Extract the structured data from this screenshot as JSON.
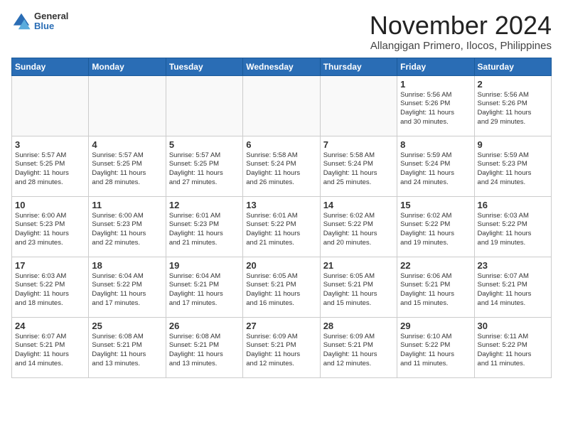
{
  "header": {
    "logo_general": "General",
    "logo_blue": "Blue",
    "month_title": "November 2024",
    "location": "Allangigan Primero, Ilocos, Philippines"
  },
  "weekdays": [
    "Sunday",
    "Monday",
    "Tuesday",
    "Wednesday",
    "Thursday",
    "Friday",
    "Saturday"
  ],
  "weeks": [
    [
      {
        "day": "",
        "info": ""
      },
      {
        "day": "",
        "info": ""
      },
      {
        "day": "",
        "info": ""
      },
      {
        "day": "",
        "info": ""
      },
      {
        "day": "",
        "info": ""
      },
      {
        "day": "1",
        "info": "Sunrise: 5:56 AM\nSunset: 5:26 PM\nDaylight: 11 hours\nand 30 minutes."
      },
      {
        "day": "2",
        "info": "Sunrise: 5:56 AM\nSunset: 5:26 PM\nDaylight: 11 hours\nand 29 minutes."
      }
    ],
    [
      {
        "day": "3",
        "info": "Sunrise: 5:57 AM\nSunset: 5:25 PM\nDaylight: 11 hours\nand 28 minutes."
      },
      {
        "day": "4",
        "info": "Sunrise: 5:57 AM\nSunset: 5:25 PM\nDaylight: 11 hours\nand 28 minutes."
      },
      {
        "day": "5",
        "info": "Sunrise: 5:57 AM\nSunset: 5:25 PM\nDaylight: 11 hours\nand 27 minutes."
      },
      {
        "day": "6",
        "info": "Sunrise: 5:58 AM\nSunset: 5:24 PM\nDaylight: 11 hours\nand 26 minutes."
      },
      {
        "day": "7",
        "info": "Sunrise: 5:58 AM\nSunset: 5:24 PM\nDaylight: 11 hours\nand 25 minutes."
      },
      {
        "day": "8",
        "info": "Sunrise: 5:59 AM\nSunset: 5:24 PM\nDaylight: 11 hours\nand 24 minutes."
      },
      {
        "day": "9",
        "info": "Sunrise: 5:59 AM\nSunset: 5:23 PM\nDaylight: 11 hours\nand 24 minutes."
      }
    ],
    [
      {
        "day": "10",
        "info": "Sunrise: 6:00 AM\nSunset: 5:23 PM\nDaylight: 11 hours\nand 23 minutes."
      },
      {
        "day": "11",
        "info": "Sunrise: 6:00 AM\nSunset: 5:23 PM\nDaylight: 11 hours\nand 22 minutes."
      },
      {
        "day": "12",
        "info": "Sunrise: 6:01 AM\nSunset: 5:23 PM\nDaylight: 11 hours\nand 21 minutes."
      },
      {
        "day": "13",
        "info": "Sunrise: 6:01 AM\nSunset: 5:22 PM\nDaylight: 11 hours\nand 21 minutes."
      },
      {
        "day": "14",
        "info": "Sunrise: 6:02 AM\nSunset: 5:22 PM\nDaylight: 11 hours\nand 20 minutes."
      },
      {
        "day": "15",
        "info": "Sunrise: 6:02 AM\nSunset: 5:22 PM\nDaylight: 11 hours\nand 19 minutes."
      },
      {
        "day": "16",
        "info": "Sunrise: 6:03 AM\nSunset: 5:22 PM\nDaylight: 11 hours\nand 19 minutes."
      }
    ],
    [
      {
        "day": "17",
        "info": "Sunrise: 6:03 AM\nSunset: 5:22 PM\nDaylight: 11 hours\nand 18 minutes."
      },
      {
        "day": "18",
        "info": "Sunrise: 6:04 AM\nSunset: 5:22 PM\nDaylight: 11 hours\nand 17 minutes."
      },
      {
        "day": "19",
        "info": "Sunrise: 6:04 AM\nSunset: 5:21 PM\nDaylight: 11 hours\nand 17 minutes."
      },
      {
        "day": "20",
        "info": "Sunrise: 6:05 AM\nSunset: 5:21 PM\nDaylight: 11 hours\nand 16 minutes."
      },
      {
        "day": "21",
        "info": "Sunrise: 6:05 AM\nSunset: 5:21 PM\nDaylight: 11 hours\nand 15 minutes."
      },
      {
        "day": "22",
        "info": "Sunrise: 6:06 AM\nSunset: 5:21 PM\nDaylight: 11 hours\nand 15 minutes."
      },
      {
        "day": "23",
        "info": "Sunrise: 6:07 AM\nSunset: 5:21 PM\nDaylight: 11 hours\nand 14 minutes."
      }
    ],
    [
      {
        "day": "24",
        "info": "Sunrise: 6:07 AM\nSunset: 5:21 PM\nDaylight: 11 hours\nand 14 minutes."
      },
      {
        "day": "25",
        "info": "Sunrise: 6:08 AM\nSunset: 5:21 PM\nDaylight: 11 hours\nand 13 minutes."
      },
      {
        "day": "26",
        "info": "Sunrise: 6:08 AM\nSunset: 5:21 PM\nDaylight: 11 hours\nand 13 minutes."
      },
      {
        "day": "27",
        "info": "Sunrise: 6:09 AM\nSunset: 5:21 PM\nDaylight: 11 hours\nand 12 minutes."
      },
      {
        "day": "28",
        "info": "Sunrise: 6:09 AM\nSunset: 5:21 PM\nDaylight: 11 hours\nand 12 minutes."
      },
      {
        "day": "29",
        "info": "Sunrise: 6:10 AM\nSunset: 5:22 PM\nDaylight: 11 hours\nand 11 minutes."
      },
      {
        "day": "30",
        "info": "Sunrise: 6:11 AM\nSunset: 5:22 PM\nDaylight: 11 hours\nand 11 minutes."
      }
    ]
  ]
}
